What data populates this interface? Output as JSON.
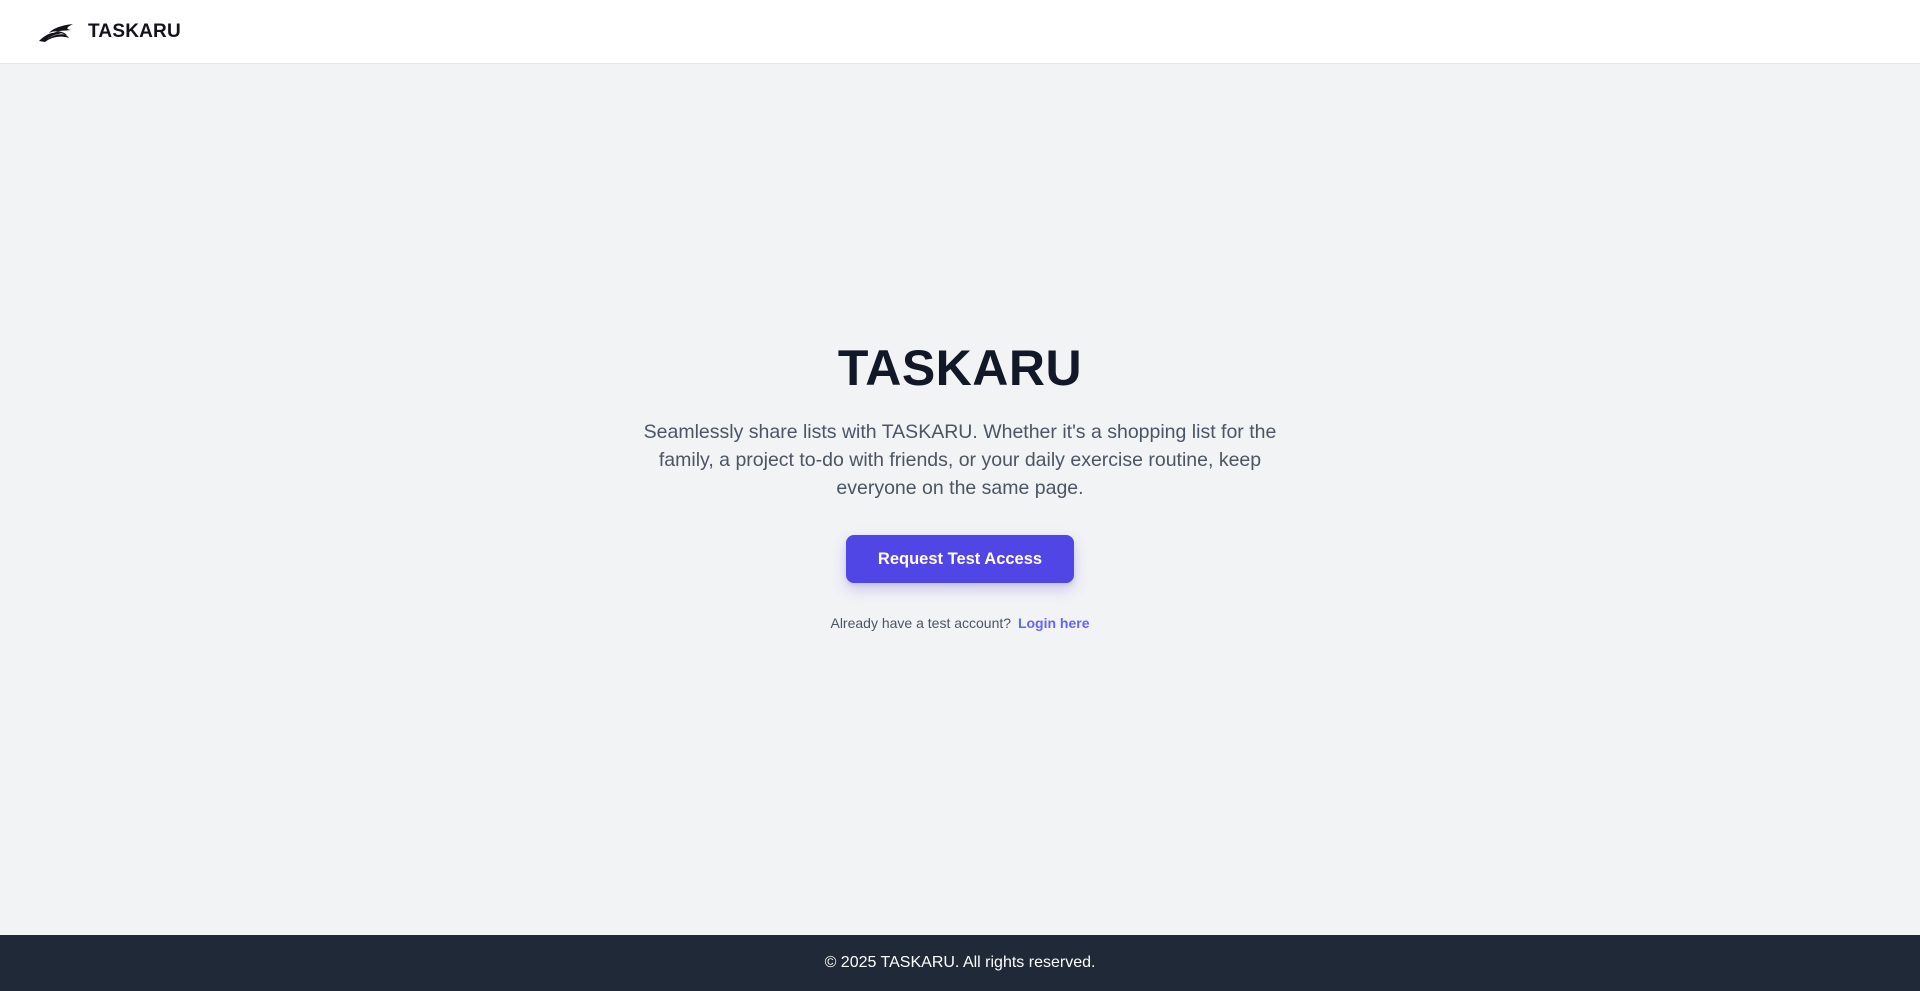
{
  "header": {
    "brand_name": "TASKARU",
    "logo_icon": "swoosh-logo-icon"
  },
  "hero": {
    "title": "TASKARU",
    "description": "Seamlessly share lists with TASKARU. Whether it's a shopping list for the family, a project to-do with friends, or your daily exercise routine, keep everyone on the same page.",
    "cta_label": "Request Test Access",
    "login_prompt": "Already have a test account?",
    "login_link": "Login here"
  },
  "footer": {
    "copyright": "© 2025 TASKARU. All rights reserved."
  },
  "colors": {
    "accent": "#4f46e5",
    "link": "#6366f1",
    "background": "#f2f3f5",
    "footer": "#1f2937"
  }
}
